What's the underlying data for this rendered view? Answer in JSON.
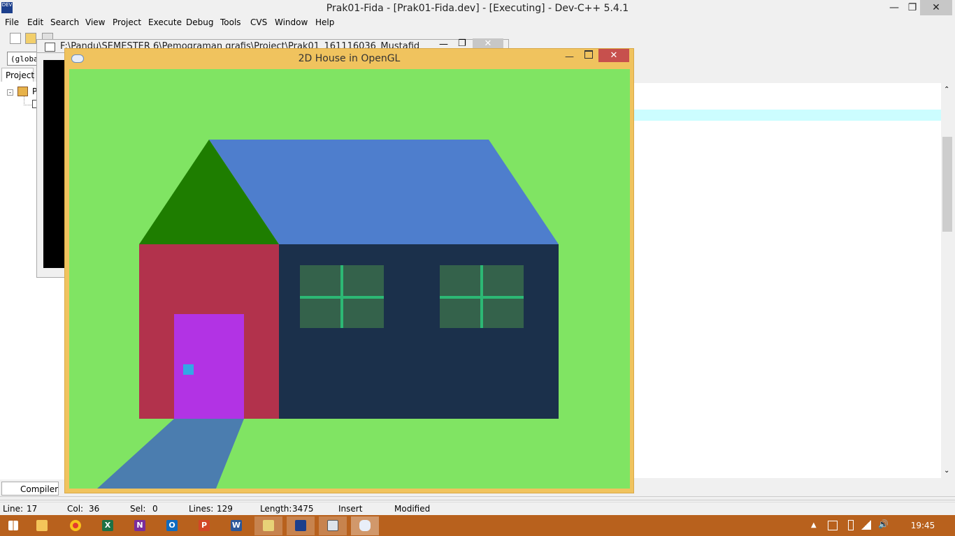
{
  "window": {
    "title": "Prak01-Fida - [Prak01-Fida.dev] - [Executing] - Dev-C++ 5.4.1",
    "minimize_icon": "minimize-icon",
    "restore_icon": "restore-icon",
    "close_icon": "close-icon"
  },
  "menu": [
    "File",
    "Edit",
    "Search",
    "View",
    "Project",
    "Execute",
    "Debug",
    "Tools",
    "CVS",
    "Window",
    "Help"
  ],
  "toolbar": {
    "scope_value": "(globa"
  },
  "project_panel": {
    "tab_label": "Project",
    "tree_root_label": "P"
  },
  "console": {
    "title": "F:\\Pandu\\SEMESTER 6\\Pemograman grafis\\Project\\Prak01_161116036_Mustafid"
  },
  "bottom": {
    "compiler_tab": "Compiler"
  },
  "status": {
    "line_label": "Line:",
    "line_value": "17",
    "col_label": "Col:",
    "col_value": "36",
    "sel_label": "Sel:",
    "sel_value": "0",
    "lines_label": "Lines:",
    "lines_value": "129",
    "length_label": "Length:",
    "length_value": "3475",
    "mode": "Insert",
    "state": "Modified"
  },
  "gl_window": {
    "title": "2D House in OpenGL",
    "colors": {
      "background": "#80e463",
      "roof": "#4e7ecd",
      "gable": "#1e7d00",
      "front_wall": "#b2324c",
      "side_wall": "#1b304b",
      "window": "#34624b",
      "window_frame": "#2cb874",
      "door": "#b233e4",
      "door_knob": "#33a7e6",
      "path": "#4b7daf"
    }
  },
  "taskbar": {
    "clock": "19:45",
    "apps": [
      {
        "name": "start-icon"
      },
      {
        "name": "file-explorer-icon"
      },
      {
        "name": "chrome-icon"
      },
      {
        "name": "excel-icon"
      },
      {
        "name": "onenote-icon"
      },
      {
        "name": "outlook-icon"
      },
      {
        "name": "powerpoint-icon"
      },
      {
        "name": "word-icon"
      },
      {
        "name": "folder-icon"
      },
      {
        "name": "devcpp-icon"
      },
      {
        "name": "console-icon"
      },
      {
        "name": "opengl-window-icon"
      }
    ]
  }
}
